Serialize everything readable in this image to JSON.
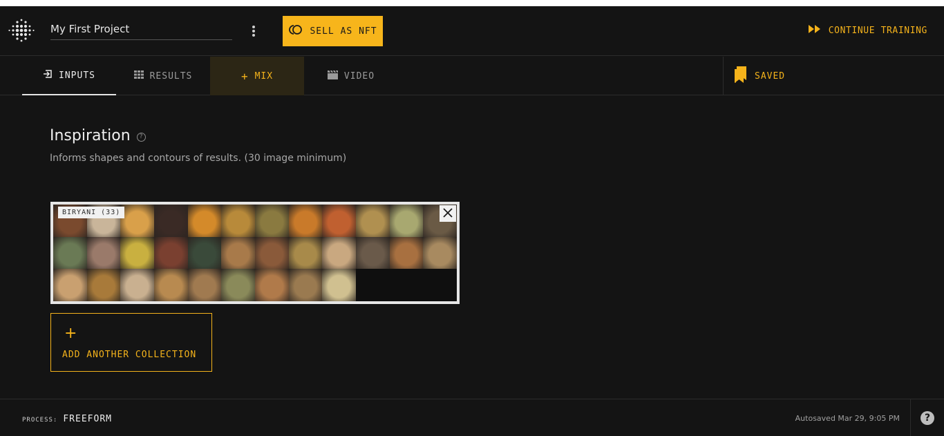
{
  "header": {
    "project_name": "My First Project",
    "nft_button": "SELL AS NFT",
    "continue_training": "CONTINUE TRAINING",
    "accent": "#f5b31b"
  },
  "tabs": {
    "inputs": "INPUTS",
    "results": "RESULTS",
    "mix": "MIX",
    "video": "VIDEO",
    "saved": "SAVED"
  },
  "main": {
    "title": "Inspiration",
    "description": "Informs shapes and contours of results. (30 image minimum)",
    "collection": {
      "label": "BIRYANI (33)",
      "image_count": 33,
      "thumb_colors": [
        "#7a4a2e",
        "#c9b59a",
        "#d9a04a",
        "#3a2a25",
        "#d48a2a",
        "#b88a3a",
        "#8a7a40",
        "#c97a2a",
        "#c06030",
        "#b09050",
        "#a8a870",
        "#6a5a45",
        "#6a7a55",
        "#9a7a6a",
        "#c9b040",
        "#7a4030",
        "#3a4a3a",
        "#a87a4a",
        "#8a5a3a",
        "#a88a4a",
        "#c9a880",
        "#6a5a4a",
        "#a87040",
        "#a88a60",
        "#c9a070",
        "#a87a3a",
        "#c9b090",
        "#b88a50",
        "#a07a50",
        "#8a8a5a",
        "#b07a4a",
        "#9a7a50",
        "#d0c090"
      ]
    },
    "add_collection": "ADD ANOTHER COLLECTION"
  },
  "footer": {
    "process_key": "PROCESS:",
    "process_value": "FREEFORM",
    "autosave": "Autosaved Mar 29, 9:05 PM"
  }
}
